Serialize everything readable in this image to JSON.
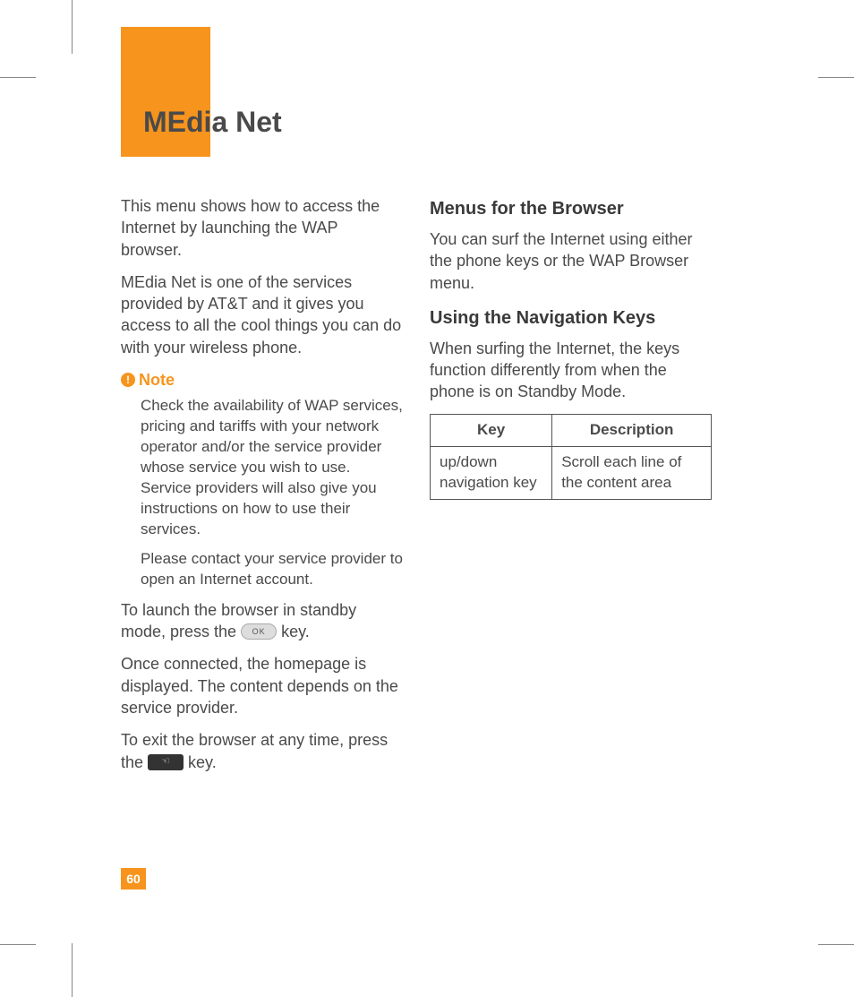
{
  "page": {
    "title": "MEdia Net",
    "number": "60"
  },
  "left": {
    "p1": "This menu shows how to access the Internet by launching the WAP browser.",
    "p2": "MEdia Net is one of the services provided by AT&T and it gives you access to all the cool things you can do with your wireless phone.",
    "note_label": "Note",
    "note1": "Check the availability of WAP services, pricing and tariffs with your network operator and/or the service provider whose service you wish to use. Service providers will also give you instructions on how to use their services.",
    "note2": "Please contact your service provider to open an Internet account.",
    "p3a": "To launch the browser in standby mode, press the ",
    "p3b": " key.",
    "ok_label": "OK",
    "p4": "Once connected, the homepage is displayed. The content depends on the service provider.",
    "p5a": "To exit the browser at any time, press the ",
    "p5b": " key.",
    "end_glyph": "☜"
  },
  "right": {
    "h1": "Menus for the Browser",
    "p1": "You can surf the Internet using either the phone keys or the WAP Browser menu.",
    "h2": "Using the Navigation Keys",
    "p2": "When surfing the Internet, the keys function differently from when the phone is on Standby Mode.",
    "table": {
      "head_key": "Key",
      "head_desc": "Description",
      "row1_key": "up/down navigation key",
      "row1_desc": "Scroll each line of the content area"
    }
  }
}
